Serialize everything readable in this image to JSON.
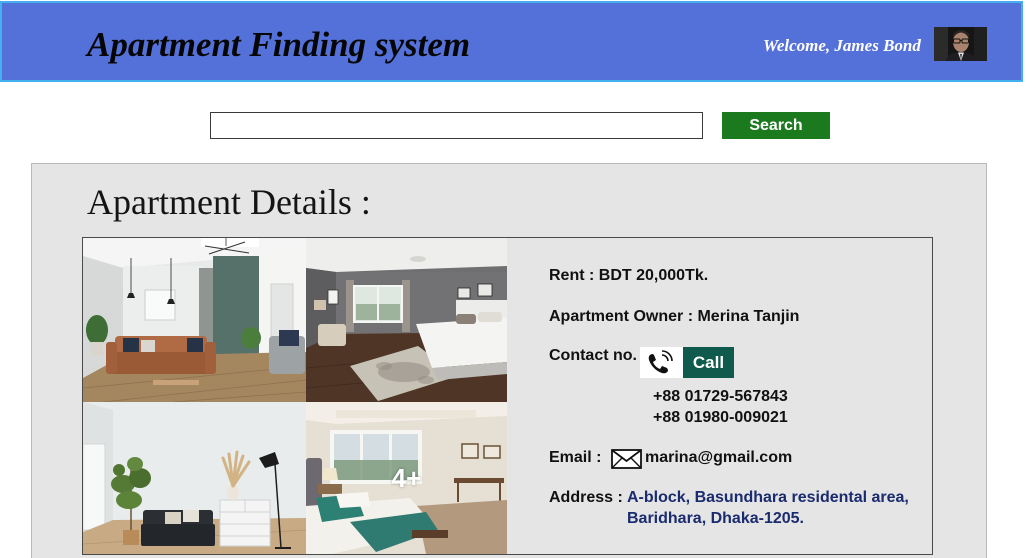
{
  "header": {
    "title": "Apartment Finding system",
    "welcome": "Welcome, James Bond"
  },
  "search": {
    "button_label": "Search"
  },
  "details": {
    "heading": "Apartment Details :",
    "gallery": {
      "more_label": "4+"
    },
    "rent": {
      "label": "Rent :",
      "value": "BDT 20,000Tk."
    },
    "owner": {
      "label": "Apartment Owner :",
      "value": "Merina Tanjin"
    },
    "contact": {
      "label": "Contact no.",
      "call_label": "Call",
      "phones": [
        "+88 01729-567843",
        "+88 01980-009021"
      ]
    },
    "email": {
      "label": "Email :",
      "value": "marina@gmail.com"
    },
    "address": {
      "label": "Address :",
      "lines": [
        "A-block, Basundhara residental area,",
        "Baridhara, Dhaka-1205."
      ]
    }
  },
  "icons": {
    "avatar": "user-avatar",
    "phone": "phone-icon",
    "email": "envelope-icon",
    "photos": [
      "living-room-photo",
      "bedroom-photo",
      "lounge-photo",
      "guest-bedroom-photo"
    ]
  },
  "colors": {
    "header_bg": "#5470d9",
    "header_border": "#45b0ef",
    "search_button": "#1b7a1e",
    "panel_bg": "#e5e5e5",
    "card_border": "#4a4a4a",
    "call_button": "#0f5a4c",
    "address_text": "#1a2b6e"
  }
}
